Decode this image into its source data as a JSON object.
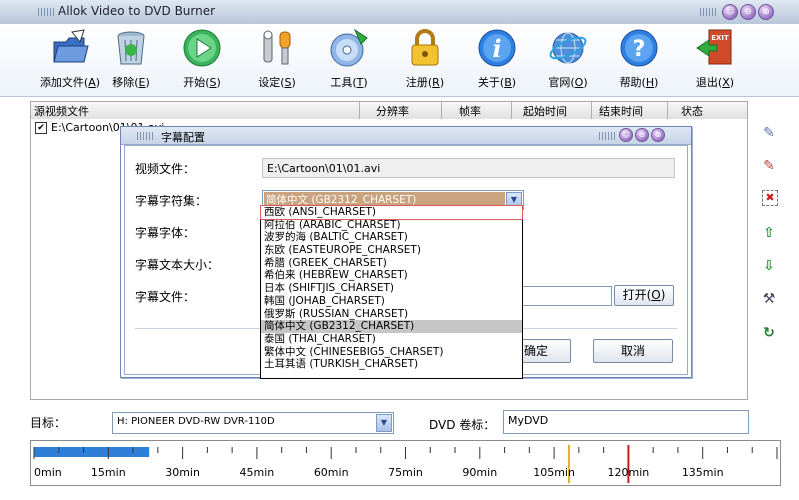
{
  "window": {
    "title": "Allok Video to DVD Burner",
    "controls": [
      "☺",
      "⊖",
      "⊗"
    ]
  },
  "toolbar": [
    {
      "id": "add",
      "label": "添加文件(",
      "key": "A",
      "icon": "folder-add-icon"
    },
    {
      "id": "remove",
      "label": "移除(",
      "key": "E",
      "icon": "recycle-bin-icon"
    },
    {
      "id": "start",
      "label": "开始(",
      "key": "S",
      "icon": "play-icon"
    },
    {
      "id": "settings",
      "label": "设定(",
      "key": "S",
      "icon": "wrench-icon"
    },
    {
      "id": "tools",
      "label": "工具(",
      "key": "T",
      "icon": "disc-tool-icon"
    },
    {
      "id": "register",
      "label": "注册(",
      "key": "R",
      "icon": "lock-icon"
    },
    {
      "id": "about",
      "label": "关于(",
      "key": "B",
      "icon": "info-icon"
    },
    {
      "id": "website",
      "label": "官网(",
      "key": "O",
      "icon": "globe-icon"
    },
    {
      "id": "help",
      "label": "帮助(",
      "key": "H",
      "icon": "help-icon"
    },
    {
      "id": "exit",
      "label": "退出(",
      "key": "X",
      "icon": "exit-icon"
    }
  ],
  "file_list": {
    "columns": [
      "源视频文件",
      "分辨率",
      "帧率",
      "起始时间",
      "结束时间",
      "状态"
    ],
    "rows": [
      {
        "checked": true,
        "file": "E:\\Cartoon\\01\\01.avi"
      }
    ]
  },
  "dialog": {
    "title": "字幕配置",
    "labels": {
      "video_file": "视频文件：",
      "charset": "字幕字符集：",
      "font": "字幕字体：",
      "size": "字幕文本大小：",
      "sub_file": "字幕文件："
    },
    "video_file_value": "E:\\Cartoon\\01\\01.avi",
    "charset_value": "简体中文 (GB2312_CHARSET)",
    "buttons": {
      "open": "打开(",
      "open_key": "O",
      "ok": "确定",
      "cancel": "取消"
    }
  },
  "charset_options": [
    "西欧 (ANSI_CHARSET)",
    "阿拉伯 (ARABIC_CHARSET)",
    "波罗的海 (BALTIC_CHARSET)",
    "东欧 (EASTEUROPE_CHARSET)",
    "希腊 (GREEK_CHARSET)",
    "希伯来 (HEBREW_CHARSET)",
    "日本 (SHIFTJIS_CHARSET)",
    "韩国 (JOHAB_CHARSET)",
    "俄罗斯 (RUSSIAN_CHARSET)",
    "简体中文 (GB2312_CHARSET)",
    "泰国 (THAI_CHARSET)",
    "繁体中文 (CHINESEBIG5_CHARSET)",
    "土耳其语 (TURKISH_CHARSET)"
  ],
  "charset_selected_index": 9,
  "charset_highlighted_index": 0,
  "target": {
    "label": "目标：",
    "value": "H: PIONEER  DVD-RW  DVR-110D"
  },
  "volume": {
    "label": "DVD 卷标：",
    "value": "MyDVD"
  },
  "timeline": {
    "labels": [
      "0min",
      "15min",
      "30min",
      "45min",
      "60min",
      "75min",
      "90min",
      "105min",
      "120min",
      "135min"
    ],
    "used_fraction": 0.155,
    "warn_marker": 108,
    "limit_marker": 120
  }
}
